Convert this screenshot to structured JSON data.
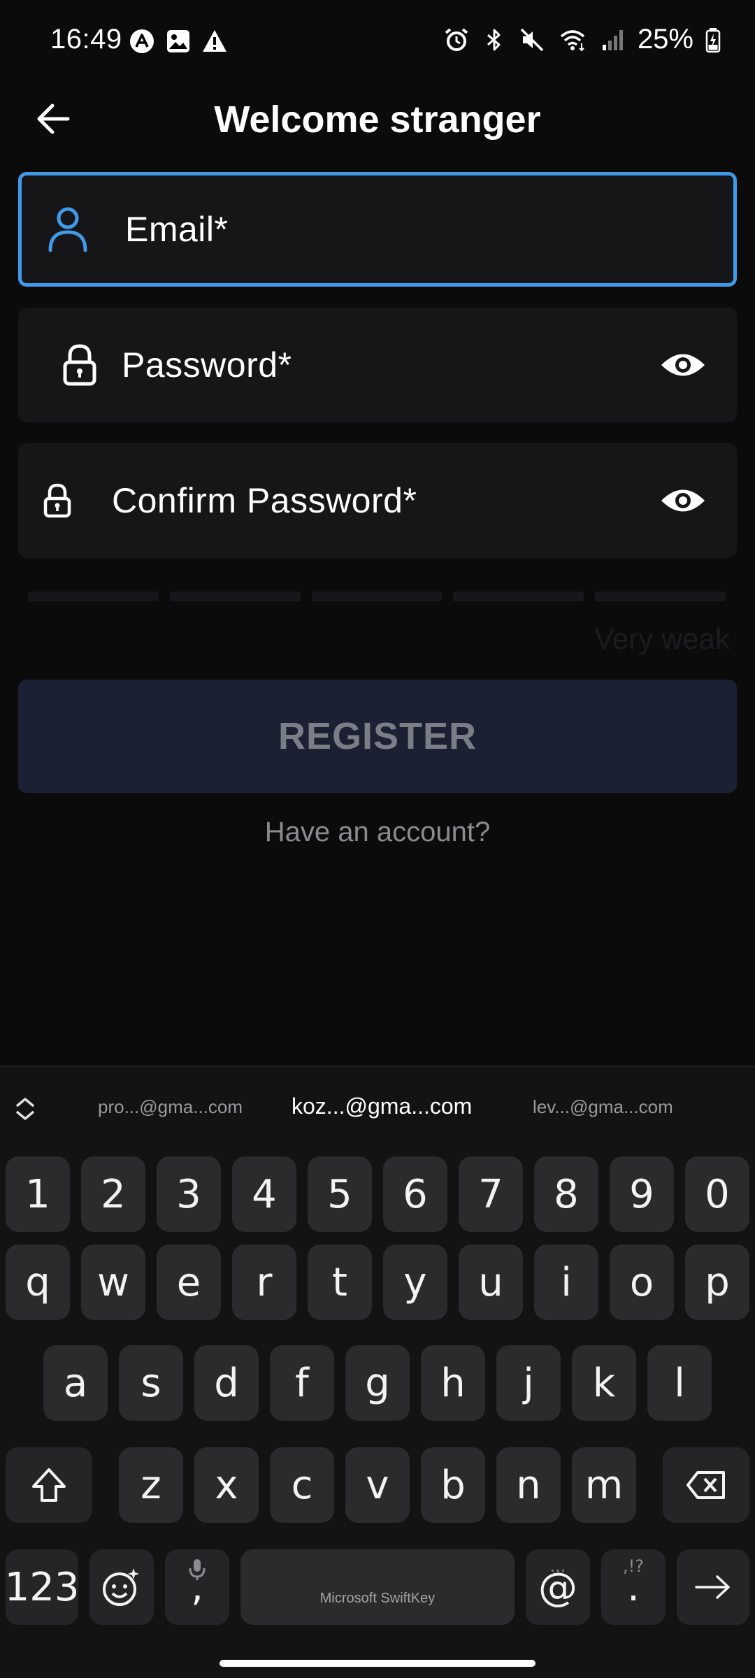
{
  "status_bar": {
    "time": "16:49",
    "battery": "25%",
    "left_icons": [
      "app-notification-icon",
      "image-icon",
      "warning-icon"
    ],
    "right_icons": [
      "alarm-icon",
      "bluetooth-icon",
      "mute-icon",
      "wifi-icon",
      "signal-icon",
      "battery-icon"
    ]
  },
  "app_bar": {
    "title": "Welcome stranger",
    "back_icon": "arrow-left-icon"
  },
  "form": {
    "email_label": "Email*",
    "password_label": "Password*",
    "confirm_label": "Confirm Password*",
    "strength_label": "Very weak",
    "strength_level": 0,
    "register_label": "REGISTER",
    "have_account": "Have an account?"
  },
  "colors": {
    "accent": "#3f9bea",
    "background": "#0b0b0c",
    "field_bg": "#161618",
    "register_bg": "#1b2032"
  },
  "keyboard": {
    "suggestions": [
      "pro...@gma...com",
      "koz...@gma...com",
      "lev...@gma...com"
    ],
    "row_numbers": [
      "1",
      "2",
      "3",
      "4",
      "5",
      "6",
      "7",
      "8",
      "9",
      "0"
    ],
    "row1": [
      "q",
      "w",
      "e",
      "r",
      "t",
      "y",
      "u",
      "i",
      "o",
      "p"
    ],
    "row2": [
      "a",
      "s",
      "d",
      "f",
      "g",
      "h",
      "j",
      "k",
      "l"
    ],
    "row3": [
      "z",
      "x",
      "c",
      "v",
      "b",
      "n",
      "m"
    ],
    "key_123": "123",
    "comma": ",",
    "space_label": "Microsoft SwiftKey",
    "at": "@",
    "at_sub": "...",
    "period": ".",
    "period_sub": ",!?"
  }
}
